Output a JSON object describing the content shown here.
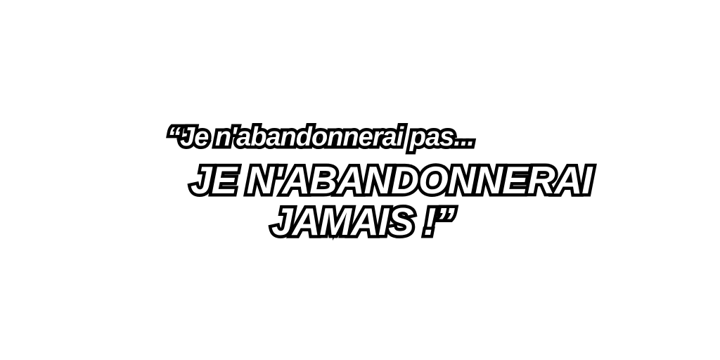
{
  "quote": {
    "line1": "“Je n'abandonnerai pas...",
    "line2": "JE N'ABANDONNERAI",
    "line3": "JAMAIS !”"
  },
  "colors": {
    "background": "#ffffff",
    "text_fill": "#ffffff",
    "text_outline": "#000000"
  }
}
